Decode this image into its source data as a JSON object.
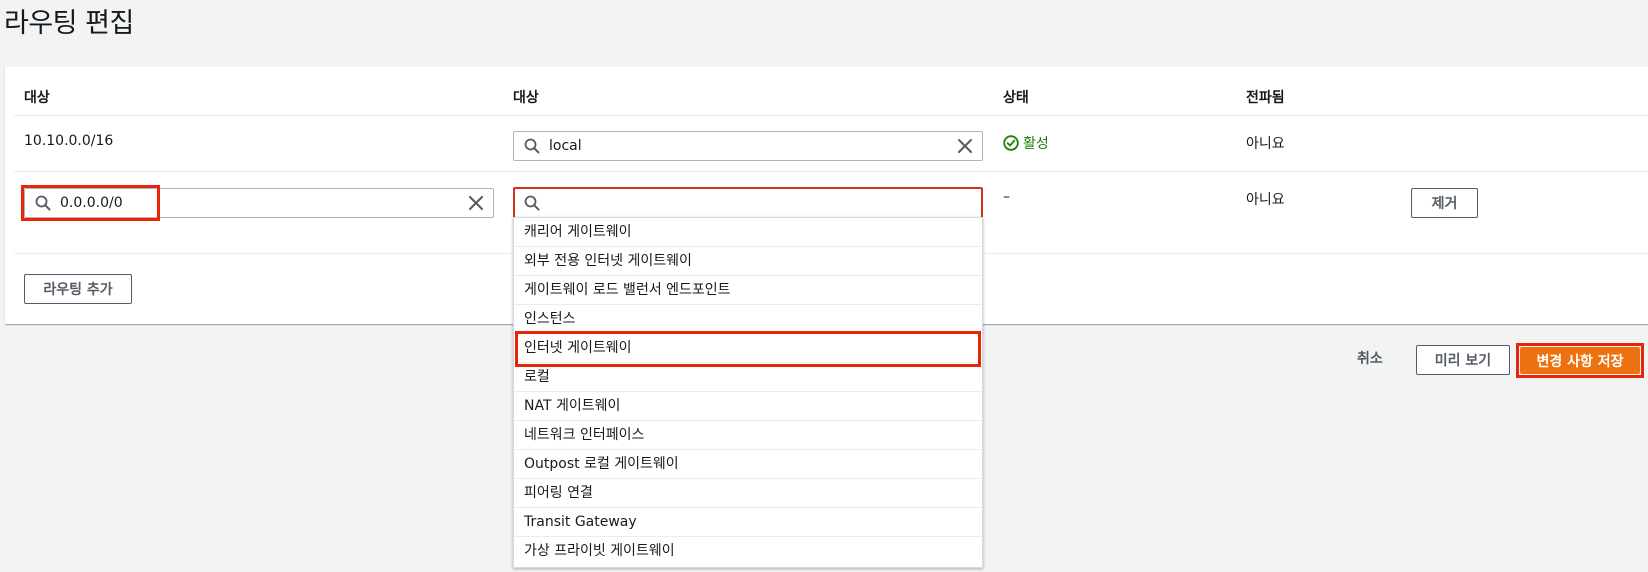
{
  "page": {
    "title": "라우팅 편집"
  },
  "table": {
    "headers": [
      "대상",
      "대상",
      "상태",
      "전파됨"
    ],
    "rows": [
      {
        "destination": "10.10.0.0/16",
        "target": "local",
        "status": "활성",
        "propagated": "아니요"
      },
      {
        "destination": "0.0.0.0/0",
        "target": "",
        "status": "–",
        "propagated": "아니요",
        "remove_label": "제거"
      }
    ],
    "add_route_label": "라우팅 추가"
  },
  "dropdown": {
    "options": [
      "캐리어 게이트웨이",
      "외부 전용 인터넷 게이트웨이",
      "게이트웨이 로드 밸런서 엔드포인트",
      "인스턴스",
      "인터넷 게이트웨이",
      "로컬",
      "NAT 게이트웨이",
      "네트워크 인터페이스",
      "Outpost 로컬 게이트웨이",
      "피어링 연결",
      "Transit Gateway",
      "가상 프라이빗 게이트웨이"
    ],
    "highlighted_option": "인터넷 게이트웨이"
  },
  "footer": {
    "cancel_label": "취소",
    "preview_label": "미리 보기",
    "save_label": "변경 사항 저장"
  },
  "colors": {
    "primary": "#ec7211",
    "active_status": "#1d8102",
    "annotation_highlight": "#e8250b",
    "background": "#f2f3f3"
  },
  "icons": [
    "search-icon",
    "clear-icon",
    "check-circle-icon"
  ]
}
